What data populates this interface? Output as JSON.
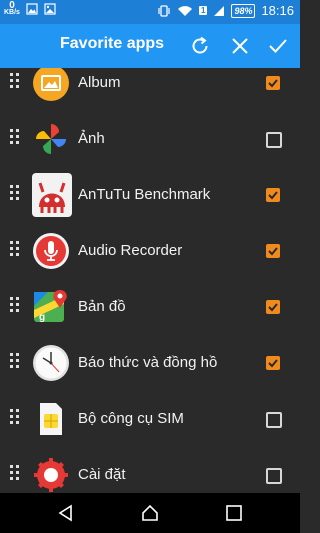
{
  "status_bar": {
    "data_rate_value": "0",
    "data_rate_unit": "KB/s",
    "battery": "98%",
    "sim_slot": "1",
    "time": "18:16"
  },
  "app_bar": {
    "title": "Favorite apps",
    "icons": [
      "refresh-icon",
      "close-icon",
      "check-icon"
    ]
  },
  "apps": [
    {
      "label": "Album",
      "checked": true,
      "icon": "album-icon"
    },
    {
      "label": "Ảnh",
      "checked": false,
      "icon": "photos-pinwheel-icon"
    },
    {
      "label": "AnTuTu Benchmark",
      "checked": true,
      "icon": "antutu-icon"
    },
    {
      "label": "Audio Recorder",
      "checked": true,
      "icon": "microphone-icon"
    },
    {
      "label": "Bản đồ",
      "checked": true,
      "icon": "maps-icon"
    },
    {
      "label": "Báo thức và đồng hồ",
      "checked": true,
      "icon": "clock-icon"
    },
    {
      "label": "Bộ công cụ SIM",
      "checked": false,
      "icon": "sim-card-icon"
    },
    {
      "label": "Cài đặt",
      "checked": false,
      "icon": "settings-gear-icon"
    }
  ],
  "nav_bar": {
    "buttons": [
      "back-icon",
      "home-icon",
      "recents-icon"
    ]
  },
  "colors": {
    "status_bar": "#1e7fd6",
    "app_bar": "#2196f3",
    "background": "#2a2a2a",
    "checkbox_checked": "#f08a1c"
  }
}
